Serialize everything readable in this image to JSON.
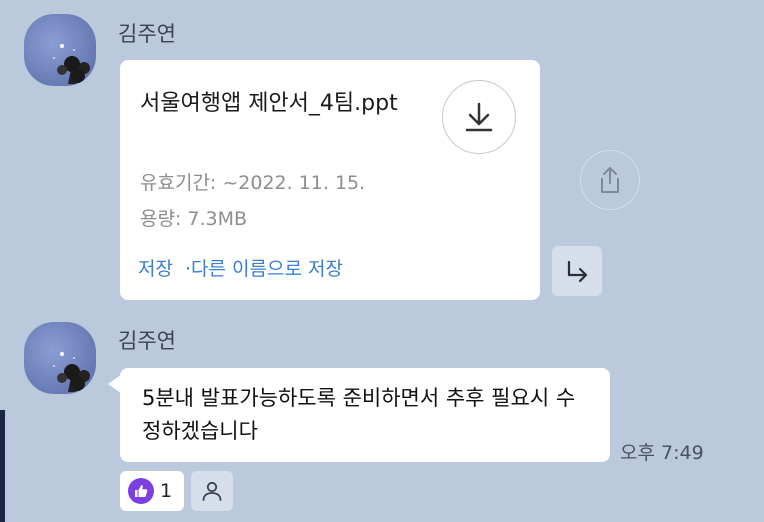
{
  "messages": [
    {
      "sender": "김주연",
      "file": {
        "name": "서울여행앱 제안서_4팀.ppt",
        "expiry": "유효기간: ~2022. 11. 15.",
        "size": "용량: 7.3MB",
        "save_label": "저장",
        "save_as_label": "·다른 이름으로 저장"
      }
    },
    {
      "sender": "김주연",
      "text": "5분내 발표가능하도록 준비하면서 추후 필요시 수정하겠습니다",
      "time": "오후 7:49",
      "reaction": {
        "count": "1"
      }
    }
  ],
  "colors": {
    "background": "#bac9dc",
    "link": "#3b7ed3",
    "like": "#7b3fe4"
  },
  "icons": [
    "download-icon",
    "share-icon",
    "forward-icon",
    "thumbs-up-icon",
    "person-icon"
  ]
}
